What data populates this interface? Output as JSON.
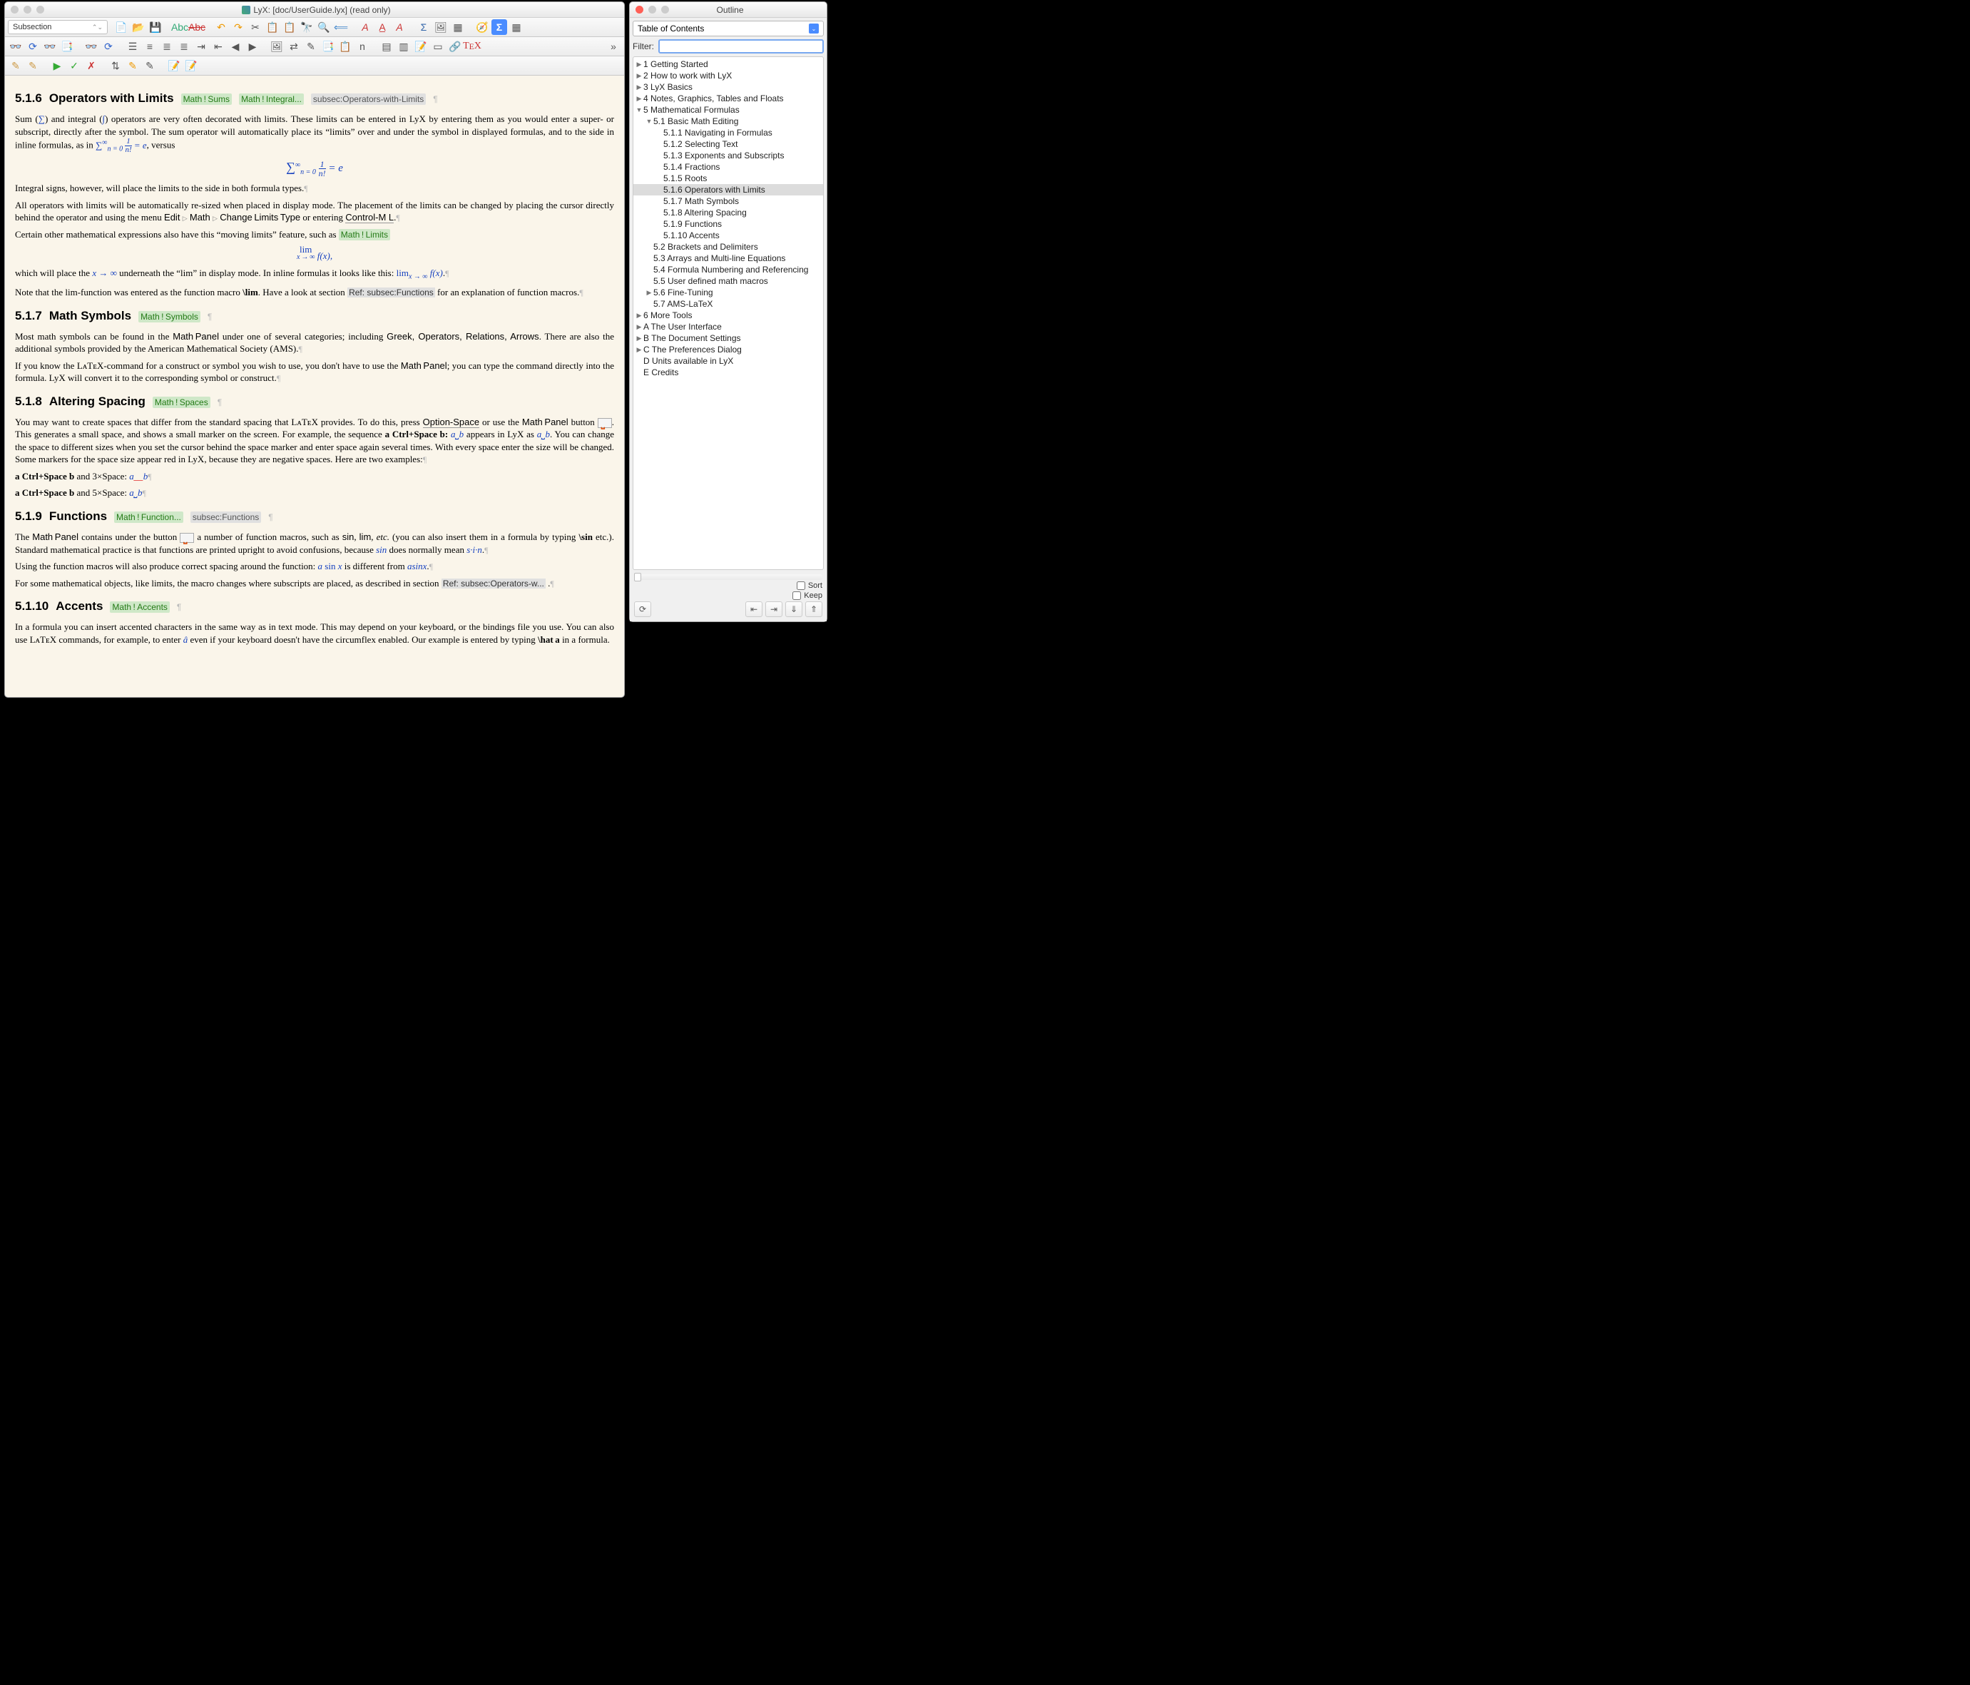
{
  "mainTitle": "LyX: [doc/UserGuide.lyx] (read only)",
  "outlineTitle": "Outline",
  "styleCombo": "Subsection",
  "tocCombo": "Table of Contents",
  "filterLabel": "Filter:",
  "sortLabel": "Sort",
  "keepLabel": "Keep",
  "sections": {
    "s516": {
      "num": "5.1.6",
      "title": "Operators with Limits",
      "tag1": "Math ! Sums",
      "tag2": "Math ! Integral...",
      "label": "subsec:Operators-with-Limits"
    },
    "s517": {
      "num": "5.1.7",
      "title": "Math Symbols",
      "tag1": "Math ! Symbols"
    },
    "s518": {
      "num": "5.1.8",
      "title": "Altering Spacing",
      "tag1": "Math ! Spaces"
    },
    "s519": {
      "num": "5.1.9",
      "title": "Functions",
      "tag1": "Math ! Function...",
      "label": "subsec:Functions"
    },
    "s5110": {
      "num": "5.1.10",
      "title": "Accents",
      "tag1": "Math ! Accents"
    }
  },
  "para": {
    "p1a": "Sum (",
    "p1b": ") and integral (",
    "p1c": ") operators are very often decorated with limits. These limits can be entered in LyX by entering them as you would enter a super- or subscript, directly after the symbol. The sum operator will automatically place its “limits” over and under the symbol in displayed formulas, and to the side in inline formulas, as in ",
    "p1d": ", versus",
    "p2": "Integral signs, however, will place the limits to the side in both formula types.",
    "p3a": "All operators with limits will be automatically re-sized when placed in display mode. The placement of the limits can be changed by placing the cursor directly behind the operator and using the menu ",
    "p3b": " or entering ",
    "p3c": ".",
    "menuEdit": "Edit",
    "menuMath": "Math",
    "menuChange": "Change Limits Type",
    "shortcut": "Control-M L",
    "p4a": "Certain other mathematical expressions also have this “moving limits” feature, such as ",
    "p4tag": "Math ! Limits",
    "limdisp": "lim",
    "limsub": "x → ∞",
    "fx": "f(x)",
    "p5a": "which will place the ",
    "p5b": " underneath the “lim” in display mode. In inline formulas it looks like this: ",
    "p5c": ".",
    "p6a": "Note that the lim-function was entered as the function macro ",
    "p6b": "\\lim",
    "p6c": ". Have a look at section",
    "p6ref": "Ref: subsec:Functions",
    "p6d": " for an explanation of function macros.",
    "p7a": "Most math symbols can be found in the ",
    "p7mp": "Math Panel",
    "p7b": " under one of several categories; including ",
    "p7cats": "Greek, Operators, Relations, Arrows",
    "p7c": ". There are also the additional symbols provided by the American Mathematical Society (AMS).",
    "p8a": "If you know the LᴀTᴇX-command for a construct or symbol you wish to use, you don't have to use the ",
    "p8b": "; you can type the command directly into the formula. LyX will convert it to the corresponding symbol or construct.",
    "p9a": "You may want to create spaces that differ from the standard spacing that LᴀTᴇX provides. To do this, press ",
    "p9key": "Option-Space",
    "p9b": " or use the ",
    "p9c": " button ",
    "p9d": ". This generates a small space, and shows a small marker on the screen. For example, the sequence ",
    "p9seq": "a Ctrl+Space b:",
    "p9e": " appears in LyX as ",
    "p9f": ". You can change the space to different sizes when you set the cursor behind the space marker and enter space again several times. With every space enter the size will be changed. Some markers for the space size appear red in LyX, because they are negative spaces. Here are two examples:",
    "ex1a": "a Ctrl+Space b",
    "ex1b": " and 3×Space: ",
    "ex2a": "a Ctrl+Space b",
    "ex2b": " and 5×Space: ",
    "p10a": "The ",
    "p10b": " contains under the button ",
    "p10c": " a number of function macros, such as ",
    "p10fns": "sin",
    "p10fns2": "lim",
    "p10etc": "etc.",
    "p10d": " (you can also insert them in a formula by typing ",
    "p10sin": "\\sin",
    "p10e": " etc.). Standard mathematical practice is that functions are printed upright to avoid confusions, because ",
    "p10f": " does normally mean ",
    "p10g": ".",
    "p11a": "Using the function macros will also produce correct spacing around the function: ",
    "p11b": " is different from ",
    "p11c": ".",
    "p12a": "For some mathematical objects, like limits, the macro changes where subscripts are placed, as described in section",
    "p12ref": "Ref: subsec:Operators-w...",
    "p13a": "In a formula you can insert accented characters in the same way as in text mode. This may depend on your keyboard, or the bindings file you use. You can also use LᴀTᴇX commands, for example, to enter ",
    "p13b": " even if your keyboard doesn't have the circumflex enabled. Our example is entered by typing ",
    "p13hat": "\\hat a",
    "p13c": " in a formula."
  },
  "tree": [
    {
      "l": 0,
      "a": "r",
      "t": "1 Getting Started"
    },
    {
      "l": 0,
      "a": "r",
      "t": "2 How to work with LyX"
    },
    {
      "l": 0,
      "a": "r",
      "t": "3 LyX Basics"
    },
    {
      "l": 0,
      "a": "r",
      "t": "4 Notes, Graphics, Tables and Floats"
    },
    {
      "l": 0,
      "a": "d",
      "t": "5 Mathematical Formulas"
    },
    {
      "l": 1,
      "a": "d",
      "t": "5.1 Basic Math Editing"
    },
    {
      "l": 2,
      "a": "",
      "t": "5.1.1 Navigating in Formulas"
    },
    {
      "l": 2,
      "a": "",
      "t": "5.1.2 Selecting Text"
    },
    {
      "l": 2,
      "a": "",
      "t": "5.1.3 Exponents and Subscripts"
    },
    {
      "l": 2,
      "a": "",
      "t": "5.1.4 Fractions"
    },
    {
      "l": 2,
      "a": "",
      "t": "5.1.5 Roots"
    },
    {
      "l": 2,
      "a": "",
      "t": "5.1.6 Operators with Limits",
      "sel": true
    },
    {
      "l": 2,
      "a": "",
      "t": "5.1.7 Math Symbols"
    },
    {
      "l": 2,
      "a": "",
      "t": "5.1.8 Altering Spacing"
    },
    {
      "l": 2,
      "a": "",
      "t": "5.1.9 Functions"
    },
    {
      "l": 2,
      "a": "",
      "t": "5.1.10 Accents"
    },
    {
      "l": 1,
      "a": "",
      "t": "5.2 Brackets and Delimiters"
    },
    {
      "l": 1,
      "a": "",
      "t": "5.3 Arrays and Multi-line Equations"
    },
    {
      "l": 1,
      "a": "",
      "t": "5.4 Formula Numbering and Referencing"
    },
    {
      "l": 1,
      "a": "",
      "t": "5.5 User defined math macros"
    },
    {
      "l": 1,
      "a": "r",
      "t": "5.6 Fine-Tuning"
    },
    {
      "l": 1,
      "a": "",
      "t": "5.7 AMS-LaTeX"
    },
    {
      "l": 0,
      "a": "r",
      "t": "6 More Tools"
    },
    {
      "l": 0,
      "a": "r",
      "t": "A The User Interface"
    },
    {
      "l": 0,
      "a": "r",
      "t": "B The Document Settings"
    },
    {
      "l": 0,
      "a": "r",
      "t": "C The Preferences Dialog"
    },
    {
      "l": 0,
      "a": "",
      "t": "D Units available in LyX"
    },
    {
      "l": 0,
      "a": "",
      "t": "E Credits"
    }
  ]
}
